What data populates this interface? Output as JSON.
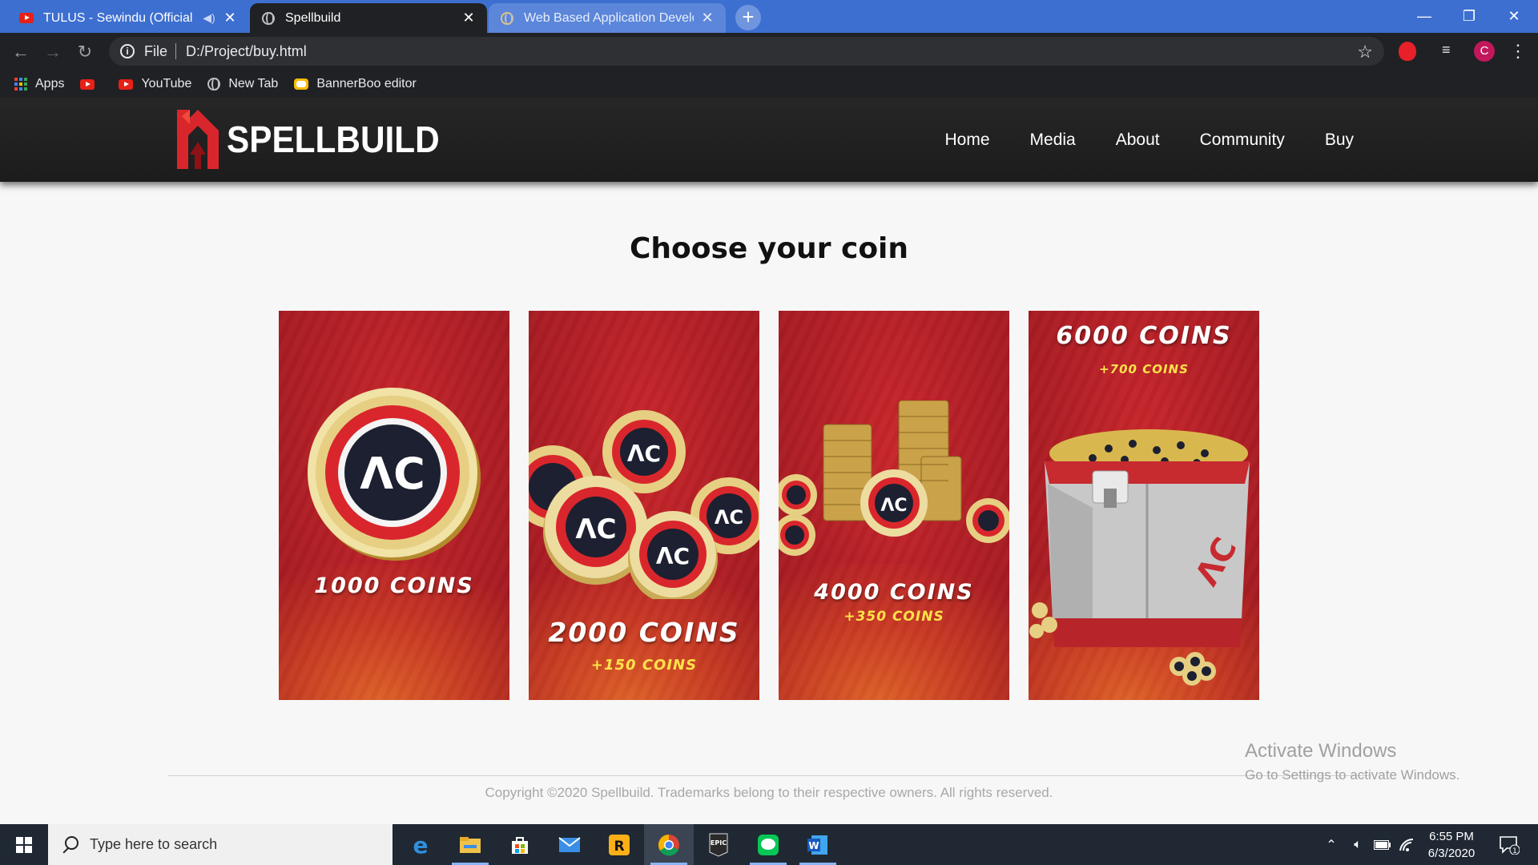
{
  "browser": {
    "tabs": [
      {
        "title": "TULUS - Sewindu (Official Mu",
        "favicon": "youtube-icon",
        "state": "inactive"
      },
      {
        "title": "Spellbuild",
        "favicon": "globe-icon",
        "state": "active"
      },
      {
        "title": "Web Based Application Developm",
        "favicon": "globe-icon",
        "state": "inactive"
      }
    ],
    "url_scheme": "File",
    "url": "D:/Project/buy.html",
    "profile_initial": "C",
    "bookmarks": [
      {
        "label": "Apps",
        "icon": "apps-grid-icon"
      },
      {
        "label": "",
        "icon": "youtube-icon"
      },
      {
        "label": "YouTube",
        "icon": "youtube-icon"
      },
      {
        "label": "New Tab",
        "icon": "globe-icon"
      },
      {
        "label": "BannerBoo editor",
        "icon": "bannerboo-icon"
      }
    ]
  },
  "site": {
    "brand": "SPELLBUILD",
    "nav": [
      "Home",
      "Media",
      "About",
      "Community",
      "Buy"
    ],
    "heading": "Choose your coin",
    "cards": [
      {
        "title": "1000 COINS",
        "bonus": ""
      },
      {
        "title": "2000 COINS",
        "bonus": "+150 COINS"
      },
      {
        "title": "4000 COINS",
        "bonus": "+350 COINS"
      },
      {
        "title": "6000 COINS",
        "bonus": "+700 COINS"
      }
    ],
    "copyright": "Copyright ©2020 Spellbuild. Trademarks belong to their respective owners. All rights reserved."
  },
  "watermark": {
    "line1": "Activate Windows",
    "line2": "Go to Settings to activate Windows."
  },
  "taskbar": {
    "search_placeholder": "Type here to search",
    "time": "6:55 PM",
    "date": "6/3/2020",
    "notification_count": "1",
    "apps": [
      "edge-icon",
      "file-explorer-icon",
      "store-icon",
      "mail-icon",
      "rockstar-icon",
      "chrome-icon",
      "epic-games-icon",
      "line-icon",
      "word-icon"
    ]
  },
  "colors": {
    "chrome_blue": "#3d6fd0",
    "nav_dark": "#1c1c1c",
    "card_red": "#b01e25",
    "bonus_yellow": "#ffe24a"
  }
}
